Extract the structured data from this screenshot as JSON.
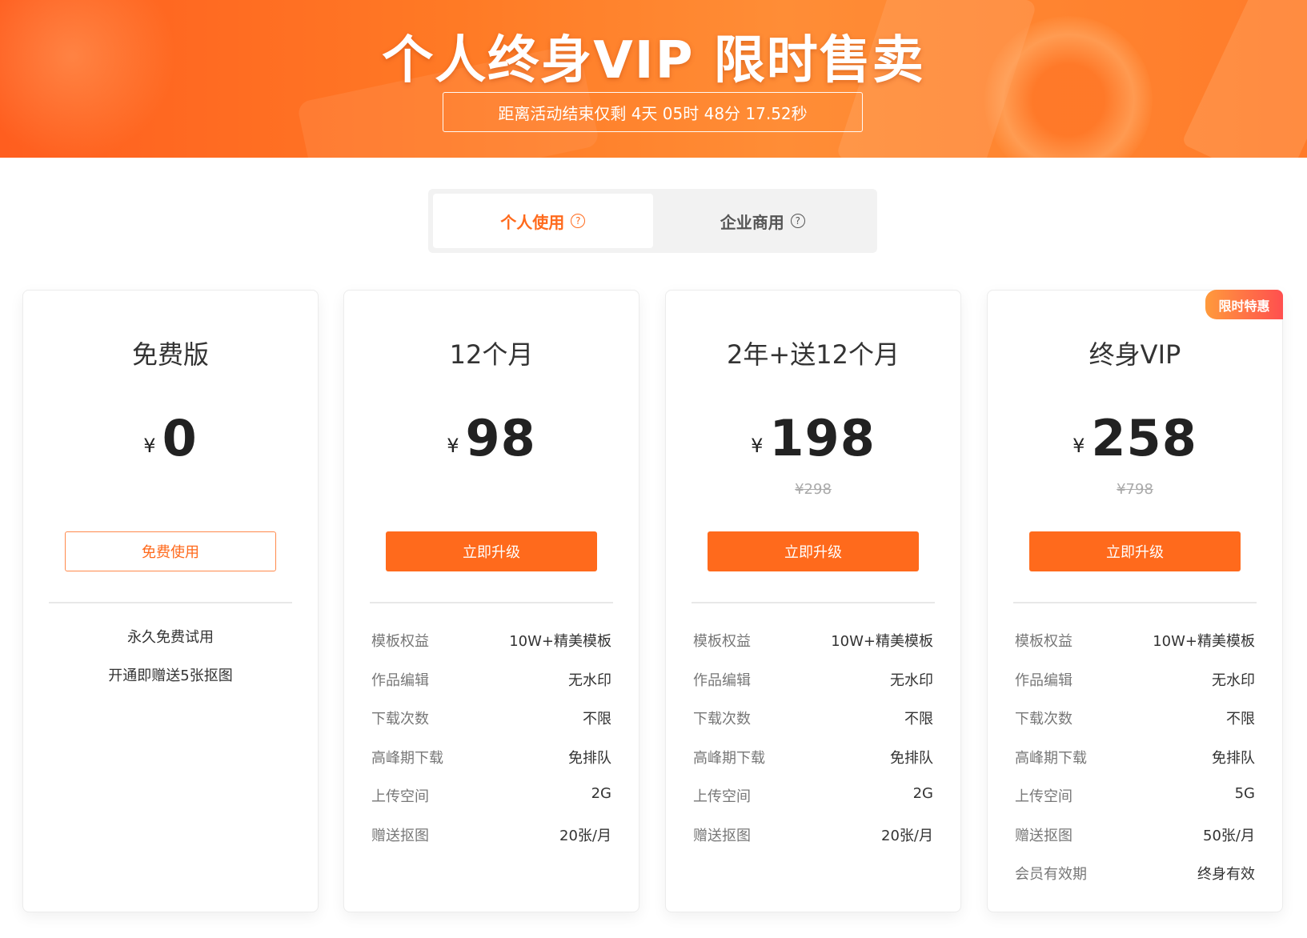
{
  "banner": {
    "title": "个人终身VIP 限时售卖",
    "countdown": {
      "prefix": "距离活动结束仅剩 ",
      "days": "4天",
      "hours": " 05时",
      "minutes": " 48分",
      "seconds": " 17.52秒"
    }
  },
  "tabs": [
    {
      "label": "个人使用",
      "icon": "question-circle-icon",
      "active": true
    },
    {
      "label": "企业商用",
      "icon": "question-circle-icon",
      "active": false
    }
  ],
  "colors": {
    "accent": "#ff6a1c",
    "badge_start": "#ff9a3c",
    "badge_end": "#ff4f4f"
  },
  "plans": [
    {
      "name": "免费版",
      "currency": "¥",
      "price": "0",
      "button": "免费使用",
      "perks": [
        "永久免费试用",
        "开通即赠送5张抠图"
      ]
    },
    {
      "name": "12个月",
      "currency": "¥",
      "price": "98",
      "button": "立即升级",
      "features": [
        {
          "label": "模板权益",
          "value": "10W+精美模板"
        },
        {
          "label": "作品编辑",
          "value": "无水印"
        },
        {
          "label": "下载次数",
          "value": "不限"
        },
        {
          "label": "高峰期下载",
          "value": "免排队"
        },
        {
          "label": "上传空间",
          "value": "2G"
        },
        {
          "label": "赠送抠图",
          "value": "20张/月"
        }
      ]
    },
    {
      "name": "2年+送12个月",
      "currency": "¥",
      "price": "198",
      "original_price": "¥298",
      "button": "立即升级",
      "features": [
        {
          "label": "模板权益",
          "value": "10W+精美模板"
        },
        {
          "label": "作品编辑",
          "value": "无水印"
        },
        {
          "label": "下载次数",
          "value": "不限"
        },
        {
          "label": "高峰期下载",
          "value": "免排队"
        },
        {
          "label": "上传空间",
          "value": "2G"
        },
        {
          "label": "赠送抠图",
          "value": "20张/月"
        }
      ]
    },
    {
      "name": "终身VIP",
      "currency": "¥",
      "price": "258",
      "original_price": "¥798",
      "badge": "限时特惠",
      "button": "立即升级",
      "features": [
        {
          "label": "模板权益",
          "value": "10W+精美模板"
        },
        {
          "label": "作品编辑",
          "value": "无水印"
        },
        {
          "label": "下载次数",
          "value": "不限"
        },
        {
          "label": "高峰期下载",
          "value": "免排队"
        },
        {
          "label": "上传空间",
          "value": "5G"
        },
        {
          "label": "赠送抠图",
          "value": "50张/月"
        },
        {
          "label": "会员有效期",
          "value": "终身有效"
        }
      ]
    }
  ]
}
